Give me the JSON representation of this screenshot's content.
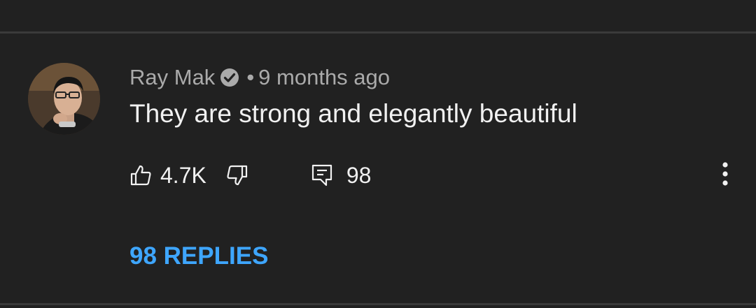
{
  "comment": {
    "author": "Ray Mak",
    "author_verified": true,
    "separator": "•",
    "timestamp": "9 months ago",
    "text": "They are strong and elegantly beautiful",
    "likes": "4.7K",
    "reply_count": "98",
    "replies_link": "98 REPLIES"
  },
  "icons": {
    "verified": "verified-check-icon",
    "like": "thumbs-up-icon",
    "dislike": "thumbs-down-icon",
    "reply": "reply-comment-icon",
    "more": "more-vertical-icon"
  },
  "colors": {
    "background": "#212121",
    "text_primary": "#f1f1f1",
    "text_secondary": "#aaaaaa",
    "link": "#3ea6ff",
    "divider": "#3a3a3a"
  }
}
